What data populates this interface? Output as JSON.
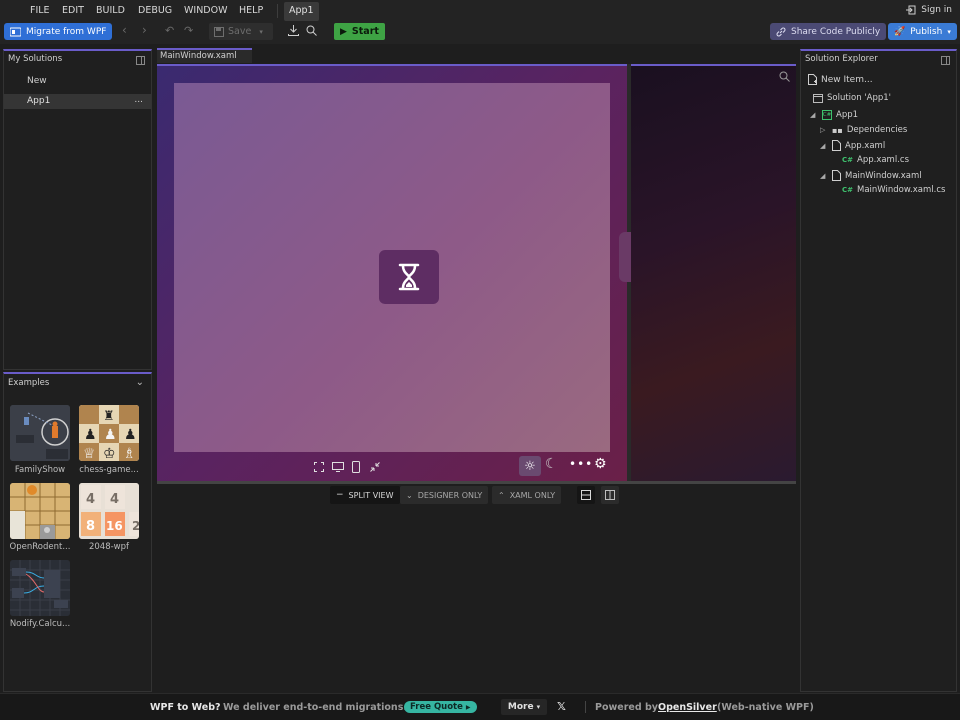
{
  "menu": {
    "items": [
      "FILE",
      "EDIT",
      "BUILD",
      "DEBUG",
      "WINDOW",
      "HELP"
    ],
    "app_tab": "App1",
    "signin": "Sign in"
  },
  "toolbar": {
    "migrate": "Migrate from WPF",
    "save": "Save",
    "start": "Start",
    "share": "Share Code Publicly",
    "publish": "Publish"
  },
  "solutions": {
    "title": "My Solutions",
    "new_label": "New",
    "items": [
      {
        "label": "App1",
        "more": "..."
      }
    ]
  },
  "examples": {
    "title": "Examples",
    "items": [
      {
        "label": "FamilyShow"
      },
      {
        "label": "chess-game..."
      },
      {
        "label": "OpenRodent..."
      },
      {
        "label": "2048-wpf"
      },
      {
        "label": "Nodify.Calcu..."
      }
    ]
  },
  "document": {
    "tab": "MainWindow.xaml"
  },
  "view_modes": {
    "split": "SPLIT VIEW",
    "designer": "DESIGNER ONLY",
    "xaml": "XAML ONLY"
  },
  "explorer": {
    "title": "Solution Explorer",
    "new_item": "New Item...",
    "solution": "Solution 'App1'",
    "project": "App1",
    "dependencies": "Dependencies",
    "app_xaml": "App.xaml",
    "app_xaml_cs": "App.xaml.cs",
    "main_xaml": "MainWindow.xaml",
    "main_xaml_cs": "MainWindow.xaml.cs",
    "cs_badge": "C#"
  },
  "footer": {
    "question": "WPF to Web?",
    "pitch": "We deliver end-to-end migrations.",
    "quote": "Free Quote",
    "more": "More",
    "x": "𝕏",
    "powered_prefix": "Powered by",
    "powered_link": "OpenSilver",
    "powered_suffix": "(Web-native WPF)"
  },
  "colors": {
    "accent": "#6a5cc9",
    "primary_button": "#2f6fd6",
    "start_button": "#3ea344",
    "share_button": "#4b4a74",
    "quote_badge": "#36b5a2"
  }
}
